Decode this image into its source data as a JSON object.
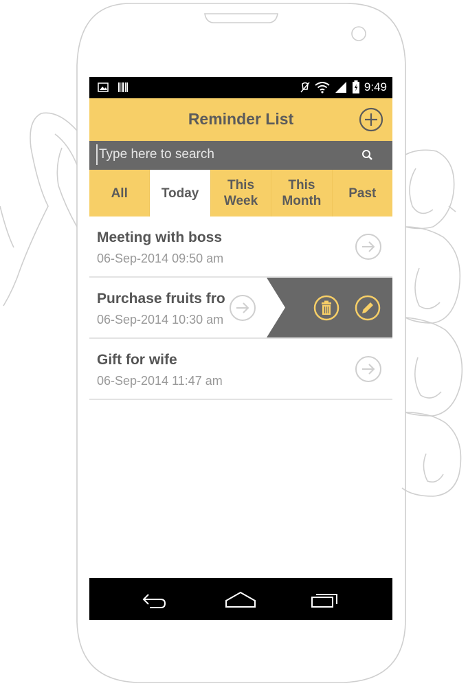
{
  "status_bar": {
    "time": "9:49"
  },
  "header": {
    "title": "Reminder List"
  },
  "search": {
    "placeholder": "Type here to search"
  },
  "tabs": [
    {
      "label": "All",
      "active": false
    },
    {
      "label": "Today",
      "active": true
    },
    {
      "label": "This\nWeek",
      "active": false
    },
    {
      "label": "This\nMonth",
      "active": false
    },
    {
      "label": "Past",
      "active": false
    }
  ],
  "reminders": [
    {
      "title": "Meeting with boss",
      "datetime": "06-Sep-2014 09:50 am"
    },
    {
      "title": "Purchase fruits fro",
      "datetime": "06-Sep-2014 10:30 am"
    },
    {
      "title": "Gift for wife",
      "datetime": "06-Sep-2014 11:47 am"
    }
  ],
  "colors": {
    "accent": "#f7cf67",
    "dark": "#686868",
    "text": "#5b5b5b",
    "subtext": "#999999"
  }
}
